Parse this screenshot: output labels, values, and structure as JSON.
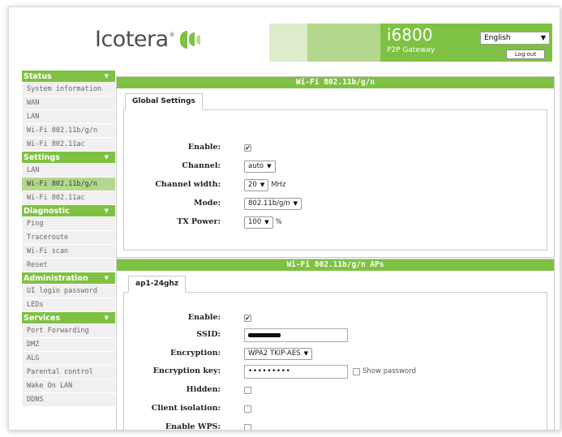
{
  "header": {
    "logo_text": "Icotera",
    "logo_reg": "®",
    "model": "i6800",
    "subtitle": "P2P Gateway",
    "language": "English",
    "logout": "Log out"
  },
  "sidebar": {
    "sections": [
      {
        "title": "Status",
        "items": [
          "System information",
          "WAN",
          "LAN",
          "Wi-Fi 802.11b/g/n",
          "Wi-Fi 802.11ac"
        ]
      },
      {
        "title": "Settings",
        "items": [
          "LAN",
          "Wi-Fi 802.11b/g/n",
          "Wi-Fi 802.11ac"
        ]
      },
      {
        "title": "Diagnostic",
        "items": [
          "Ping",
          "Traceroute",
          "Wi-Fi scan",
          "Reset"
        ]
      },
      {
        "title": "Administration",
        "items": [
          "UI login password",
          "LEDs"
        ]
      },
      {
        "title": "Services",
        "items": [
          "Port Forwarding",
          "DMZ",
          "ALG",
          "Parental control",
          "Wake On LAN",
          "DDNS"
        ]
      }
    ]
  },
  "panel1": {
    "title": "Wi-Fi 802.11b/g/n",
    "tab": "Global Settings",
    "enable_label": "Enable:",
    "channel_label": "Channel:",
    "channel_value": "auto",
    "width_label": "Channel width:",
    "width_value": "20",
    "width_unit": "MHz",
    "mode_label": "Mode:",
    "mode_value": "802.11b/g/n",
    "tx_label": "TX Power:",
    "tx_value": "100",
    "tx_unit": "%"
  },
  "panel2": {
    "title": "Wi-Fi 802.11b/g/n APs",
    "tab": "ap1-24ghz",
    "enable_label": "Enable:",
    "ssid_label": "SSID:",
    "enc_label": "Encryption:",
    "enc_value": "WPA2 TKIP-AES",
    "key_label": "Encryption key:",
    "key_value": "•••••••••",
    "show_password": "Show password",
    "hidden_label": "Hidden:",
    "isolation_label": "Client isolation:",
    "wps_label": "Enable WPS:"
  }
}
